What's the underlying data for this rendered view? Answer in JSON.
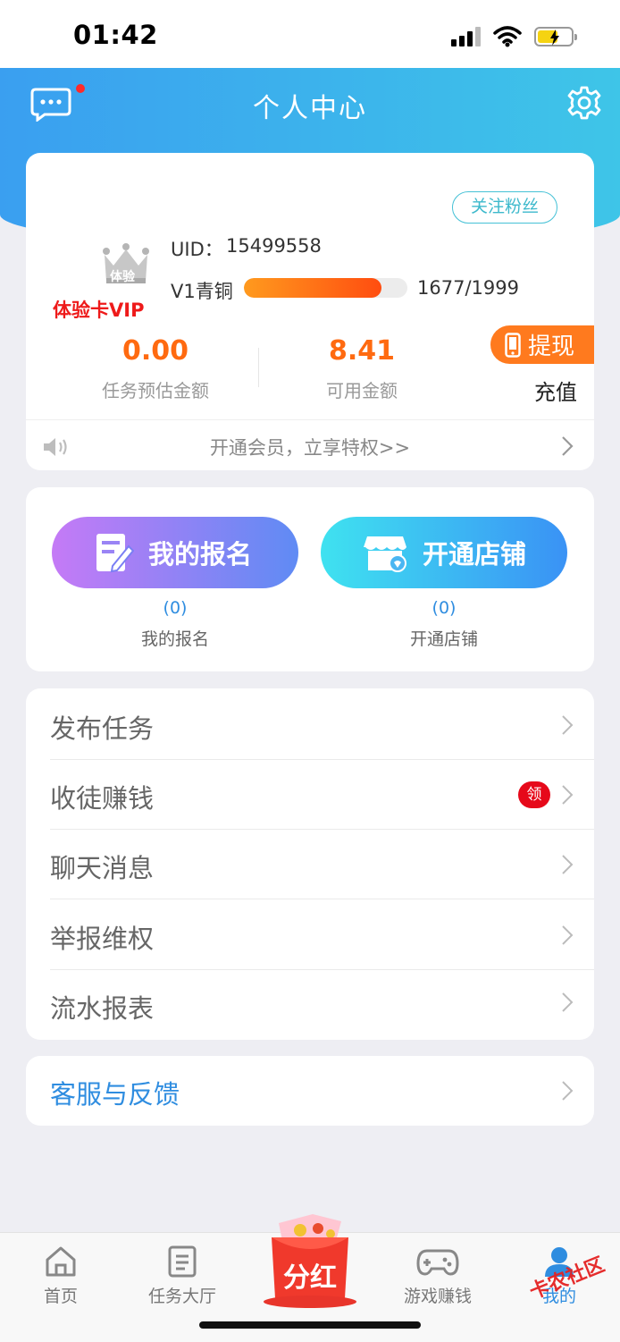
{
  "status_bar": {
    "time": "01:42"
  },
  "header": {
    "title": "个人中心"
  },
  "profile": {
    "follow_label": "关注粉丝",
    "crown_text": "体验",
    "vip_label": "体验卡VIP",
    "uid_label": "UID：",
    "uid": "15499558",
    "level_label": "V1青铜",
    "level_progress_text": "1677/1999",
    "level_progress": 0.839,
    "stats": [
      {
        "value": "0.00",
        "label": "任务预估金额"
      },
      {
        "value": "8.41",
        "label": "可用金额"
      }
    ],
    "withdraw_label": "提现",
    "recharge_label": "充值",
    "vip_promo": "开通会员，立享特权>>"
  },
  "actions": [
    {
      "label": "我的报名",
      "count": "(0)",
      "caption": "我的报名"
    },
    {
      "label": "开通店铺",
      "count": "(0)",
      "caption": "开通店铺"
    }
  ],
  "menu": [
    {
      "label": "发布任务"
    },
    {
      "label": "收徒赚钱",
      "badge": "领"
    },
    {
      "label": "聊天消息"
    },
    {
      "label": "举报维权"
    },
    {
      "label": "流水报表"
    }
  ],
  "service": {
    "label": "客服与反馈"
  },
  "tabs": [
    {
      "label": "首页",
      "icon": "home-icon"
    },
    {
      "label": "任务大厅",
      "icon": "task-hall-icon"
    },
    {
      "label": "分红",
      "icon": "red-envelope-icon"
    },
    {
      "label": "游戏赚钱",
      "icon": "gamepad-icon"
    },
    {
      "label": "我的",
      "icon": "user-icon"
    }
  ],
  "watermark": "卡农社区",
  "colors": {
    "header_start": "#3a9ff0",
    "header_end": "#3ec5e8",
    "accent_orange": "#ff6a10",
    "link_blue": "#2f8de0",
    "vip_red": "#ee1a1a"
  }
}
